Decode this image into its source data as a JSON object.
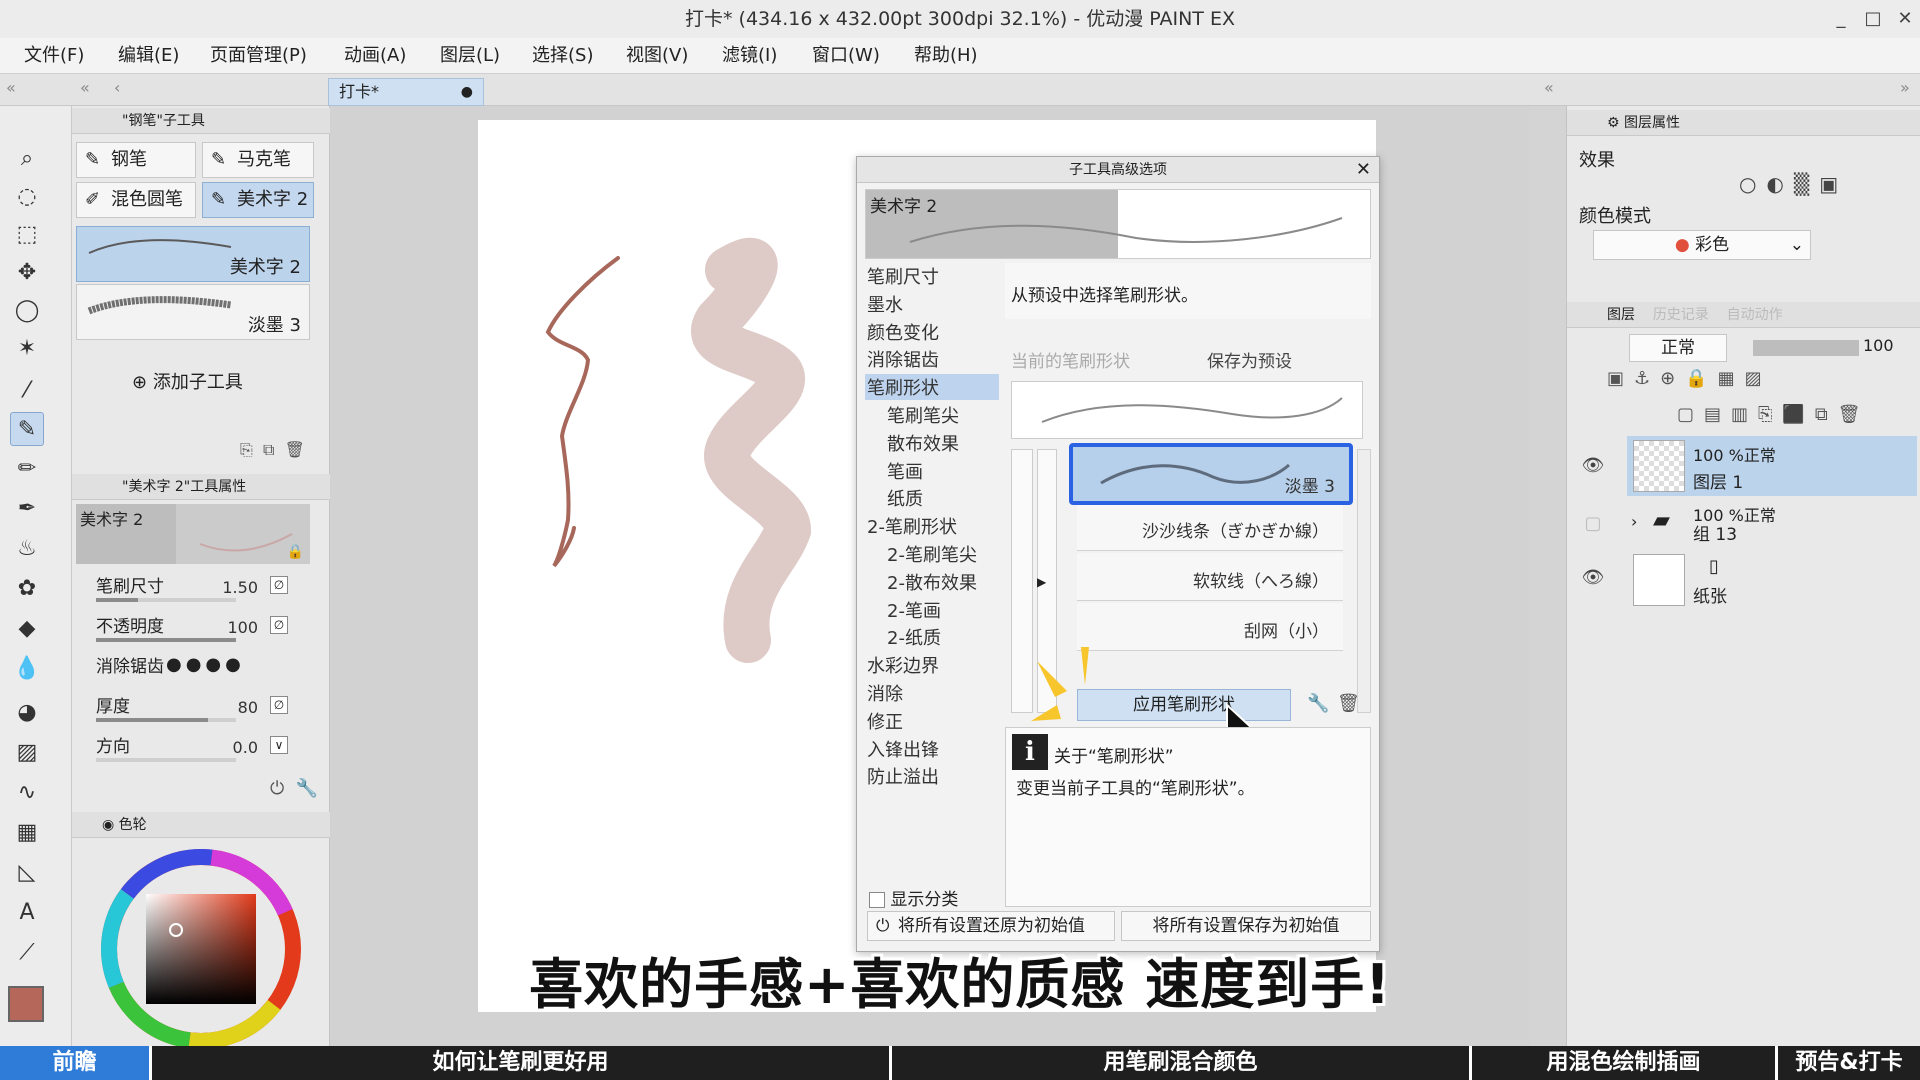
{
  "window": {
    "title": "打卡* (434.16 x 432.00pt 300dpi 32.1%)  - 优动漫 PAINT EX",
    "minimize": "_",
    "maximize": "□",
    "close": "✕"
  },
  "menu": [
    "文件(F)",
    "编辑(E)",
    "页面管理(P)",
    "动画(A)",
    "图层(L)",
    "选择(S)",
    "视图(V)",
    "滤镜(I)",
    "窗口(W)",
    "帮助(H)"
  ],
  "document_tab": {
    "label": "打卡*",
    "dot": "●"
  },
  "subtool_panel": {
    "header": "\"钢笔\"子工具",
    "buttons": [
      "钢笔",
      "马克笔",
      "混色圆笔",
      "美术字 2"
    ],
    "brushes": [
      {
        "name": "美术字 2"
      },
      {
        "name": "淡墨 3"
      }
    ],
    "add_label": "添加子工具"
  },
  "tool_property": {
    "header": "\"美术字 2\"工具属性",
    "preview_name": "美术字 2",
    "rows": [
      {
        "label": "笔刷尺寸",
        "value": "1.50",
        "fill": 0.3
      },
      {
        "label": "不透明度",
        "value": "100",
        "fill": 1.0
      },
      {
        "label": "消除锯齿",
        "value": ""
      },
      {
        "label": "厚度",
        "value": "80",
        "fill": 0.8
      },
      {
        "label": "方向",
        "value": "0.0",
        "fill": 0.0
      }
    ]
  },
  "colorwheel": {
    "header": "色轮",
    "main_color": "#b5675a",
    "sub_color": "#c98e84"
  },
  "dialog": {
    "title": "子工具高级选项",
    "close": "✕",
    "preview_name": "美术字 2",
    "categories": [
      {
        "label": "笔刷尺寸",
        "sub": false
      },
      {
        "label": "墨水",
        "sub": false
      },
      {
        "label": "颜色变化",
        "sub": false
      },
      {
        "label": "消除锯齿",
        "sub": false
      },
      {
        "label": "笔刷形状",
        "sub": false,
        "selected": true
      },
      {
        "label": "笔刷笔尖",
        "sub": true
      },
      {
        "label": "散布效果",
        "sub": true
      },
      {
        "label": "笔画",
        "sub": true
      },
      {
        "label": "纸质",
        "sub": true
      },
      {
        "label": "2-笔刷形状",
        "sub": false
      },
      {
        "label": "2-笔刷笔尖",
        "sub": true
      },
      {
        "label": "2-散布效果",
        "sub": true
      },
      {
        "label": "2-笔画",
        "sub": true
      },
      {
        "label": "2-纸质",
        "sub": true
      },
      {
        "label": "水彩边界",
        "sub": false
      },
      {
        "label": "消除",
        "sub": false
      },
      {
        "label": "修正",
        "sub": false
      },
      {
        "label": "入锋出锋",
        "sub": false
      },
      {
        "label": "防止溢出",
        "sub": false
      }
    ],
    "hint": "从预设中选择笔刷形状。",
    "current_shape_label": "当前的笔刷形状",
    "save_preset_label": "保存为预设",
    "presets": [
      "淡墨 3",
      "沙沙线条（ぎかぎか線）",
      "软软线（へろ線）",
      "刮网（小）"
    ],
    "apply_label": "应用笔刷形状",
    "info_title": "关于“笔刷形状”",
    "info_text": "变更当前子工具的“笔刷形状”。",
    "show_category_label": "显示分类",
    "reset_label": "将所有设置还原为初始值",
    "save_default_label": "将所有设置保存为初始值"
  },
  "right_panel": {
    "layer_property_tab": "图层属性",
    "effect_label": "效果",
    "color_mode_label": "颜色模式",
    "color_mode_value": "彩色",
    "layer_tabs": [
      "图层",
      "历史记录",
      "自动动作"
    ],
    "blend_mode": "正常",
    "opacity": "100",
    "layers": [
      {
        "line1": "100 %正常",
        "line2": "图层 1",
        "selected": true
      },
      {
        "line1": "100 %正常",
        "line2": "组 13",
        "selected": false
      },
      {
        "line1": "",
        "line2": "纸张",
        "selected": false
      }
    ]
  },
  "caption": "喜欢的手感+喜欢的质感 速度到手!",
  "chapters": [
    "前瞻",
    "如何让笔刷更好用",
    "用笔刷混合颜色",
    "用混色绘制插画",
    "预告&打卡"
  ],
  "accent": "#2b62e3"
}
